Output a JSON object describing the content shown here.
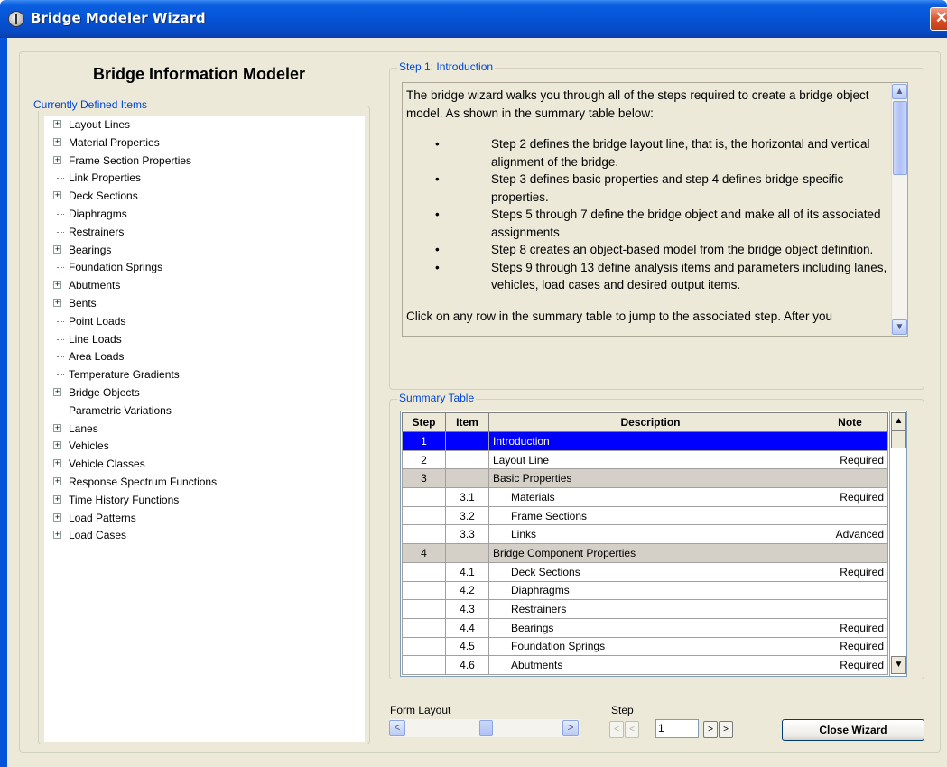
{
  "window": {
    "title": "Bridge Modeler Wizard",
    "close_glyph": "✕"
  },
  "header": {
    "title": "Bridge Information Modeler"
  },
  "tree": {
    "label": "Currently Defined Items",
    "items": [
      {
        "label": "Layout Lines",
        "expandable": true
      },
      {
        "label": "Material Properties",
        "expandable": true
      },
      {
        "label": "Frame Section Properties",
        "expandable": true
      },
      {
        "label": "Link Properties",
        "expandable": false
      },
      {
        "label": "Deck Sections",
        "expandable": true
      },
      {
        "label": "Diaphragms",
        "expandable": false
      },
      {
        "label": "Restrainers",
        "expandable": false
      },
      {
        "label": "Bearings",
        "expandable": true
      },
      {
        "label": "Foundation Springs",
        "expandable": false
      },
      {
        "label": "Abutments",
        "expandable": true
      },
      {
        "label": "Bents",
        "expandable": true
      },
      {
        "label": "Point Loads",
        "expandable": false
      },
      {
        "label": "Line Loads",
        "expandable": false
      },
      {
        "label": "Area Loads",
        "expandable": false
      },
      {
        "label": "Temperature Gradients",
        "expandable": false
      },
      {
        "label": "Bridge Objects",
        "expandable": true
      },
      {
        "label": "Parametric Variations",
        "expandable": false
      },
      {
        "label": "Lanes",
        "expandable": true
      },
      {
        "label": "Vehicles",
        "expandable": true
      },
      {
        "label": "Vehicle Classes",
        "expandable": true
      },
      {
        "label": "Response Spectrum Functions",
        "expandable": true
      },
      {
        "label": "Time History Functions",
        "expandable": true
      },
      {
        "label": "Load Patterns",
        "expandable": true
      },
      {
        "label": "Load Cases",
        "expandable": true
      }
    ]
  },
  "step_panel": {
    "label": "Step 1:  Introduction",
    "intro": "The bridge wizard walks you through all of the steps required to create a bridge object model. As shown in the summary table below:",
    "bullets": [
      "Step 2 defines the bridge layout line, that is, the horizontal and vertical alignment of the bridge.",
      "Step 3 defines basic properties and step 4 defines bridge-specific properties.",
      "Steps 5 through 7 define the bridge object and make all of its associated assignments",
      "Step 8 creates an object-based model from the bridge object definition.",
      "Steps 9 through 13 define analysis items and parameters including lanes, vehicles, load cases and desired output items."
    ],
    "tail": "Click on any row in the summary table to jump to the associated step. After you"
  },
  "summary": {
    "label": "Summary Table",
    "columns": [
      "Step",
      "Item",
      "Description",
      "Note"
    ],
    "rows": [
      {
        "step": "1",
        "item": "",
        "description": "Introduction",
        "note": "",
        "kind": "selected"
      },
      {
        "step": "2",
        "item": "",
        "description": "Layout Line",
        "note": "Required",
        "kind": "normal"
      },
      {
        "step": "3",
        "item": "",
        "description": "Basic Properties",
        "note": "",
        "kind": "group"
      },
      {
        "step": "",
        "item": "3.1",
        "description": "Materials",
        "note": "Required",
        "kind": "sub"
      },
      {
        "step": "",
        "item": "3.2",
        "description": "Frame Sections",
        "note": "",
        "kind": "sub"
      },
      {
        "step": "",
        "item": "3.3",
        "description": "Links",
        "note": "Advanced",
        "kind": "sub"
      },
      {
        "step": "4",
        "item": "",
        "description": "Bridge Component Properties",
        "note": "",
        "kind": "group"
      },
      {
        "step": "",
        "item": "4.1",
        "description": "Deck Sections",
        "note": "Required",
        "kind": "sub"
      },
      {
        "step": "",
        "item": "4.2",
        "description": "Diaphragms",
        "note": "",
        "kind": "sub"
      },
      {
        "step": "",
        "item": "4.3",
        "description": "Restrainers",
        "note": "",
        "kind": "sub"
      },
      {
        "step": "",
        "item": "4.4",
        "description": "Bearings",
        "note": "Required",
        "kind": "sub"
      },
      {
        "step": "",
        "item": "4.5",
        "description": "Foundation Springs",
        "note": "Required",
        "kind": "sub"
      },
      {
        "step": "",
        "item": "4.6",
        "description": "Abutments",
        "note": "Required",
        "kind": "sub"
      }
    ]
  },
  "footer": {
    "form_layout_label": "Form Layout",
    "step_label": "Step",
    "step_value": "1",
    "close_label": "Close Wizard",
    "prev_glyph": "<",
    "next_glyph": ">"
  }
}
